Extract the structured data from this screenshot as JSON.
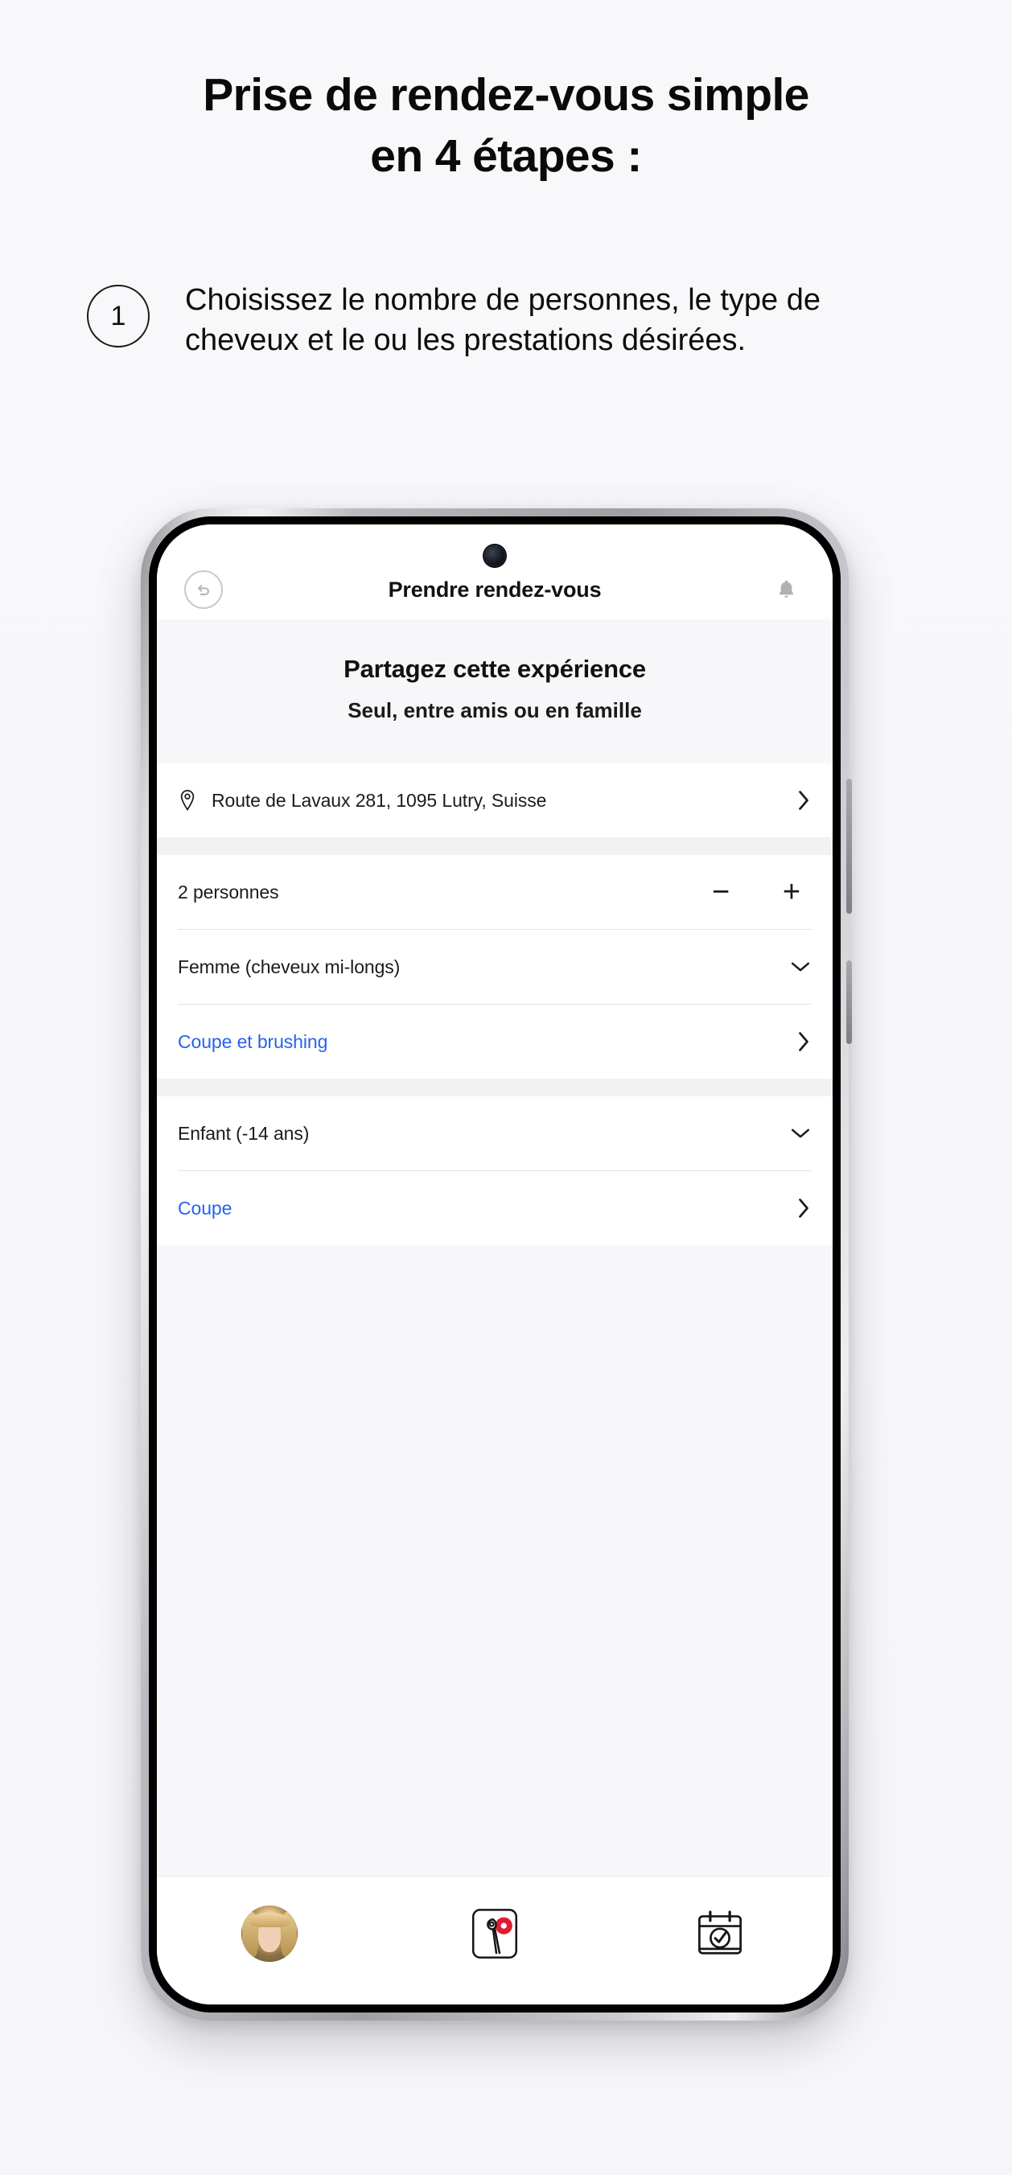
{
  "promo": {
    "heading_line1": "Prise de rendez-vous simple",
    "heading_line2": "en 4 étapes :",
    "step_number": "1",
    "step_text": "Choisissez le nombre de personnes, le type de cheveux et le ou les prestations désirées."
  },
  "app": {
    "header": {
      "title": "Prendre rendez-vous",
      "back_icon": "back-arrow-icon",
      "bell_icon": "bell-icon"
    },
    "share_banner": {
      "title": "Partagez cette expérience",
      "subtitle": "Seul, entre amis ou en famille"
    },
    "rows": {
      "address": {
        "label": "Route de Lavaux 281, 1095 Lutry, Suisse",
        "pin_icon": "map-pin-icon",
        "chevron": "chevron-right-icon"
      },
      "persons": {
        "label": "2 personnes",
        "minus": "−",
        "plus": "+"
      },
      "person1_type": {
        "label": "Femme (cheveux mi-longs)",
        "chevron": "chevron-down-icon"
      },
      "person1_service": {
        "label": "Coupe et brushing",
        "chevron": "chevron-right-icon"
      },
      "person2_type": {
        "label": "Enfant (-14 ans)",
        "chevron": "chevron-down-icon"
      },
      "person2_service": {
        "label": "Coupe",
        "chevron": "chevron-right-icon"
      }
    },
    "bottom_nav": [
      {
        "name": "profile-avatar",
        "icon": "avatar-icon"
      },
      {
        "name": "salon-card",
        "icon": "salon-card-icon"
      },
      {
        "name": "appointments",
        "icon": "calendar-check-icon"
      }
    ]
  },
  "colors": {
    "link": "#2563eb",
    "accent_red": "#e01a32",
    "page_bg": "#f7f7f9",
    "text": "#111111"
  }
}
